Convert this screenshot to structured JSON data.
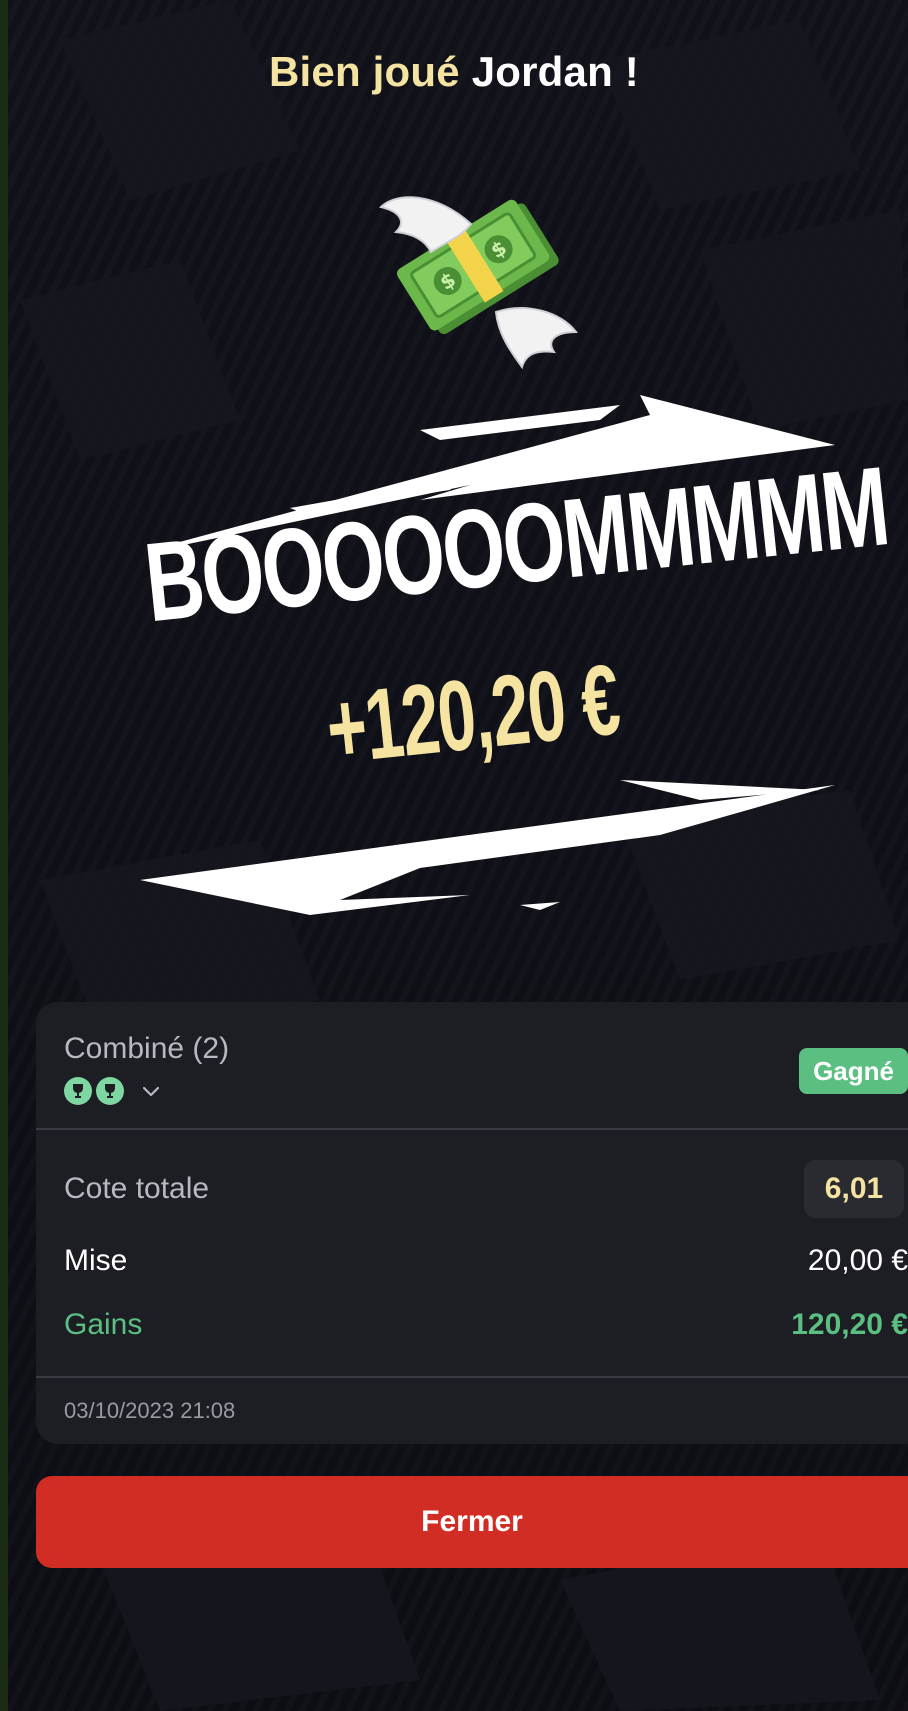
{
  "header": {
    "greeting_prefix": "Bien joué",
    "user_name": "Jordan !"
  },
  "celebration": {
    "title": "BOOOOOOMMMMM",
    "amount": "+120,20 €"
  },
  "bet": {
    "type": "Combiné (2)",
    "status": "Gagné",
    "total_odds_label": "Cote totale",
    "total_odds_value": "6,01",
    "stake_label": "Mise",
    "stake_value": "20,00 €",
    "winnings_label": "Gains",
    "winnings_value": "120,20 €",
    "timestamp": "03/10/2023 21:08",
    "selections_icons": [
      "trophy-icon",
      "trophy-icon"
    ]
  },
  "actions": {
    "close_label": "Fermer"
  },
  "colors": {
    "accent_gold": "#f4e3a1",
    "win_green": "#5cbf82",
    "danger_red": "#d22d24",
    "background": "#0f0f16",
    "card": "#1d1d24"
  }
}
